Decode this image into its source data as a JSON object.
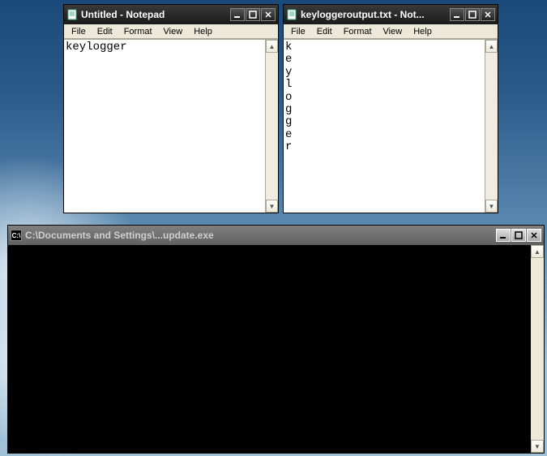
{
  "windows": {
    "notepad1": {
      "title": "Untitled - Notepad",
      "content": "keylogger"
    },
    "notepad2": {
      "title": "keyloggeroutput.txt - Not...",
      "content": "k\ne\ny\nl\no\ng\ng\ne\nr"
    },
    "cmd": {
      "title": "C:\\Documents and Settings\\...update.exe",
      "content": ""
    }
  },
  "menus": {
    "file": "File",
    "edit": "Edit",
    "format": "Format",
    "view": "View",
    "help": "Help"
  },
  "buttons": {
    "minimize": "_",
    "maximize": "□",
    "close": "X",
    "scrollup": "▲",
    "scrolldown": "▼"
  }
}
